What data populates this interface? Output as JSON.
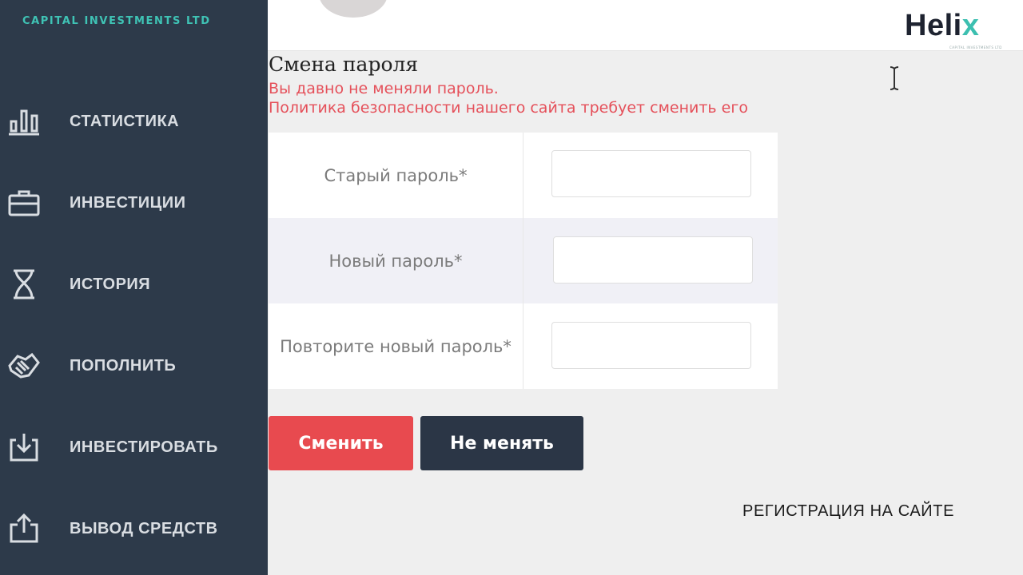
{
  "sidebar": {
    "brand": "CAPITAL INVESTMENTS LTD",
    "items": [
      {
        "label": "СТАТИСТИКА",
        "icon": "bar-chart-icon"
      },
      {
        "label": "ИНВЕСТИЦИИ",
        "icon": "briefcase-icon"
      },
      {
        "label": "ИСТОРИЯ",
        "icon": "hourglass-icon"
      },
      {
        "label": "ПОПОЛНИТЬ",
        "icon": "handshake-icon"
      },
      {
        "label": "ИНВЕСТИРОВАТЬ",
        "icon": "download-tray-icon"
      },
      {
        "label": "ВЫВОД СРЕДСТВ",
        "icon": "upload-share-icon"
      }
    ]
  },
  "header": {
    "logo": {
      "main": "Heli",
      "accent": "x",
      "subtitle": "CAPITAL INVESTMENTS LTD"
    }
  },
  "main": {
    "title": "Смена пароля",
    "warning_line1": "Вы давно не меняли пароль.",
    "warning_line2": "Политика безопасности нашего сайта требует сменить его",
    "fields": [
      {
        "label": "Старый пароль*",
        "value": ""
      },
      {
        "label": "Новый пароль*",
        "value": ""
      },
      {
        "label": "Повторите новый пароль*",
        "value": ""
      }
    ],
    "submit_label": "Сменить",
    "cancel_label": "Не менять",
    "register_link": "РЕГИСТРАЦИЯ НА САЙТЕ"
  },
  "colors": {
    "sidebar_bg": "#2d3a4a",
    "brand": "#3fc3b5",
    "warning": "#e5505a",
    "submit": "#e84a4f",
    "cancel": "#2b3646"
  }
}
